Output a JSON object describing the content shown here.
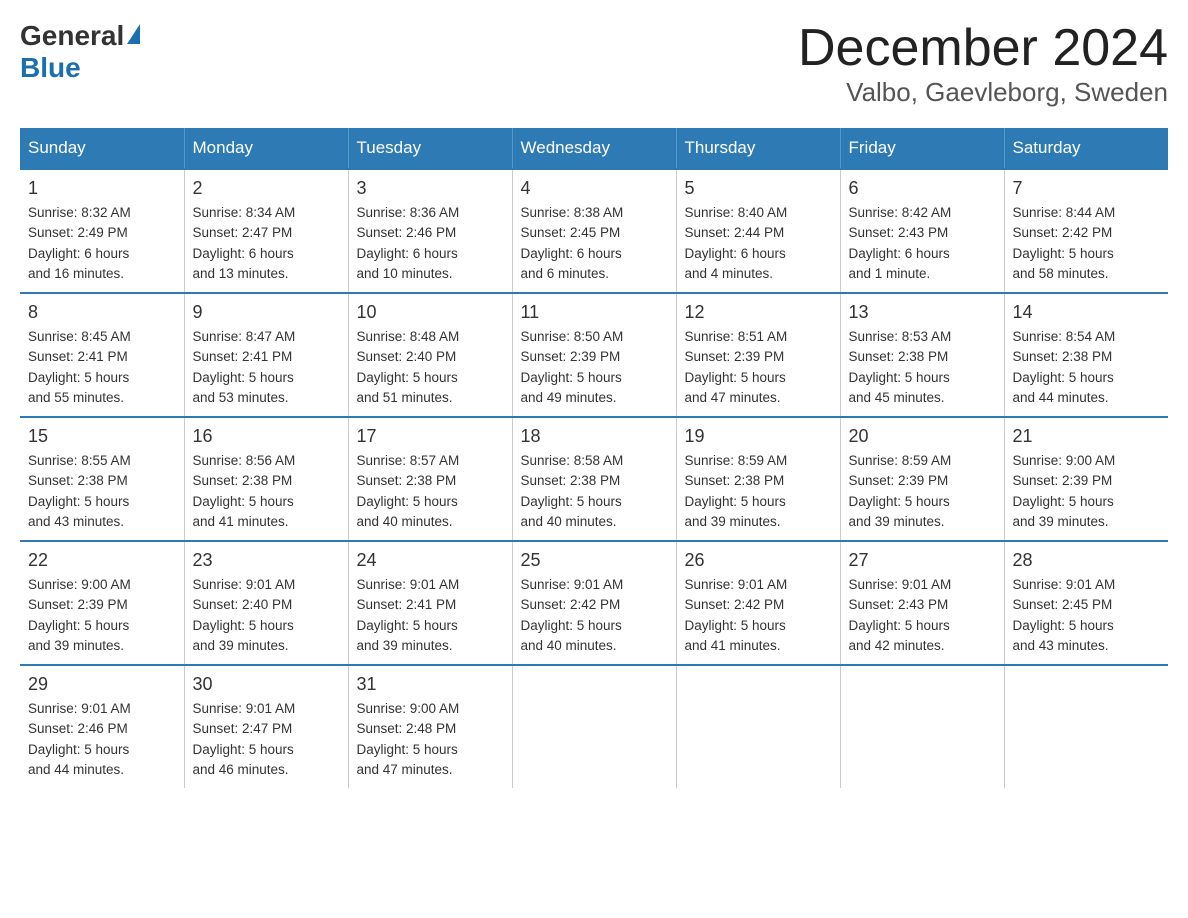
{
  "header": {
    "title": "December 2024",
    "subtitle": "Valbo, Gaevleborg, Sweden",
    "logo_general": "General",
    "logo_blue": "Blue"
  },
  "weekdays": [
    "Sunday",
    "Monday",
    "Tuesday",
    "Wednesday",
    "Thursday",
    "Friday",
    "Saturday"
  ],
  "weeks": [
    [
      {
        "day": "1",
        "info": "Sunrise: 8:32 AM\nSunset: 2:49 PM\nDaylight: 6 hours\nand 16 minutes."
      },
      {
        "day": "2",
        "info": "Sunrise: 8:34 AM\nSunset: 2:47 PM\nDaylight: 6 hours\nand 13 minutes."
      },
      {
        "day": "3",
        "info": "Sunrise: 8:36 AM\nSunset: 2:46 PM\nDaylight: 6 hours\nand 10 minutes."
      },
      {
        "day": "4",
        "info": "Sunrise: 8:38 AM\nSunset: 2:45 PM\nDaylight: 6 hours\nand 6 minutes."
      },
      {
        "day": "5",
        "info": "Sunrise: 8:40 AM\nSunset: 2:44 PM\nDaylight: 6 hours\nand 4 minutes."
      },
      {
        "day": "6",
        "info": "Sunrise: 8:42 AM\nSunset: 2:43 PM\nDaylight: 6 hours\nand 1 minute."
      },
      {
        "day": "7",
        "info": "Sunrise: 8:44 AM\nSunset: 2:42 PM\nDaylight: 5 hours\nand 58 minutes."
      }
    ],
    [
      {
        "day": "8",
        "info": "Sunrise: 8:45 AM\nSunset: 2:41 PM\nDaylight: 5 hours\nand 55 minutes."
      },
      {
        "day": "9",
        "info": "Sunrise: 8:47 AM\nSunset: 2:41 PM\nDaylight: 5 hours\nand 53 minutes."
      },
      {
        "day": "10",
        "info": "Sunrise: 8:48 AM\nSunset: 2:40 PM\nDaylight: 5 hours\nand 51 minutes."
      },
      {
        "day": "11",
        "info": "Sunrise: 8:50 AM\nSunset: 2:39 PM\nDaylight: 5 hours\nand 49 minutes."
      },
      {
        "day": "12",
        "info": "Sunrise: 8:51 AM\nSunset: 2:39 PM\nDaylight: 5 hours\nand 47 minutes."
      },
      {
        "day": "13",
        "info": "Sunrise: 8:53 AM\nSunset: 2:38 PM\nDaylight: 5 hours\nand 45 minutes."
      },
      {
        "day": "14",
        "info": "Sunrise: 8:54 AM\nSunset: 2:38 PM\nDaylight: 5 hours\nand 44 minutes."
      }
    ],
    [
      {
        "day": "15",
        "info": "Sunrise: 8:55 AM\nSunset: 2:38 PM\nDaylight: 5 hours\nand 43 minutes."
      },
      {
        "day": "16",
        "info": "Sunrise: 8:56 AM\nSunset: 2:38 PM\nDaylight: 5 hours\nand 41 minutes."
      },
      {
        "day": "17",
        "info": "Sunrise: 8:57 AM\nSunset: 2:38 PM\nDaylight: 5 hours\nand 40 minutes."
      },
      {
        "day": "18",
        "info": "Sunrise: 8:58 AM\nSunset: 2:38 PM\nDaylight: 5 hours\nand 40 minutes."
      },
      {
        "day": "19",
        "info": "Sunrise: 8:59 AM\nSunset: 2:38 PM\nDaylight: 5 hours\nand 39 minutes."
      },
      {
        "day": "20",
        "info": "Sunrise: 8:59 AM\nSunset: 2:39 PM\nDaylight: 5 hours\nand 39 minutes."
      },
      {
        "day": "21",
        "info": "Sunrise: 9:00 AM\nSunset: 2:39 PM\nDaylight: 5 hours\nand 39 minutes."
      }
    ],
    [
      {
        "day": "22",
        "info": "Sunrise: 9:00 AM\nSunset: 2:39 PM\nDaylight: 5 hours\nand 39 minutes."
      },
      {
        "day": "23",
        "info": "Sunrise: 9:01 AM\nSunset: 2:40 PM\nDaylight: 5 hours\nand 39 minutes."
      },
      {
        "day": "24",
        "info": "Sunrise: 9:01 AM\nSunset: 2:41 PM\nDaylight: 5 hours\nand 39 minutes."
      },
      {
        "day": "25",
        "info": "Sunrise: 9:01 AM\nSunset: 2:42 PM\nDaylight: 5 hours\nand 40 minutes."
      },
      {
        "day": "26",
        "info": "Sunrise: 9:01 AM\nSunset: 2:42 PM\nDaylight: 5 hours\nand 41 minutes."
      },
      {
        "day": "27",
        "info": "Sunrise: 9:01 AM\nSunset: 2:43 PM\nDaylight: 5 hours\nand 42 minutes."
      },
      {
        "day": "28",
        "info": "Sunrise: 9:01 AM\nSunset: 2:45 PM\nDaylight: 5 hours\nand 43 minutes."
      }
    ],
    [
      {
        "day": "29",
        "info": "Sunrise: 9:01 AM\nSunset: 2:46 PM\nDaylight: 5 hours\nand 44 minutes."
      },
      {
        "day": "30",
        "info": "Sunrise: 9:01 AM\nSunset: 2:47 PM\nDaylight: 5 hours\nand 46 minutes."
      },
      {
        "day": "31",
        "info": "Sunrise: 9:00 AM\nSunset: 2:48 PM\nDaylight: 5 hours\nand 47 minutes."
      },
      {
        "day": "",
        "info": ""
      },
      {
        "day": "",
        "info": ""
      },
      {
        "day": "",
        "info": ""
      },
      {
        "day": "",
        "info": ""
      }
    ]
  ]
}
